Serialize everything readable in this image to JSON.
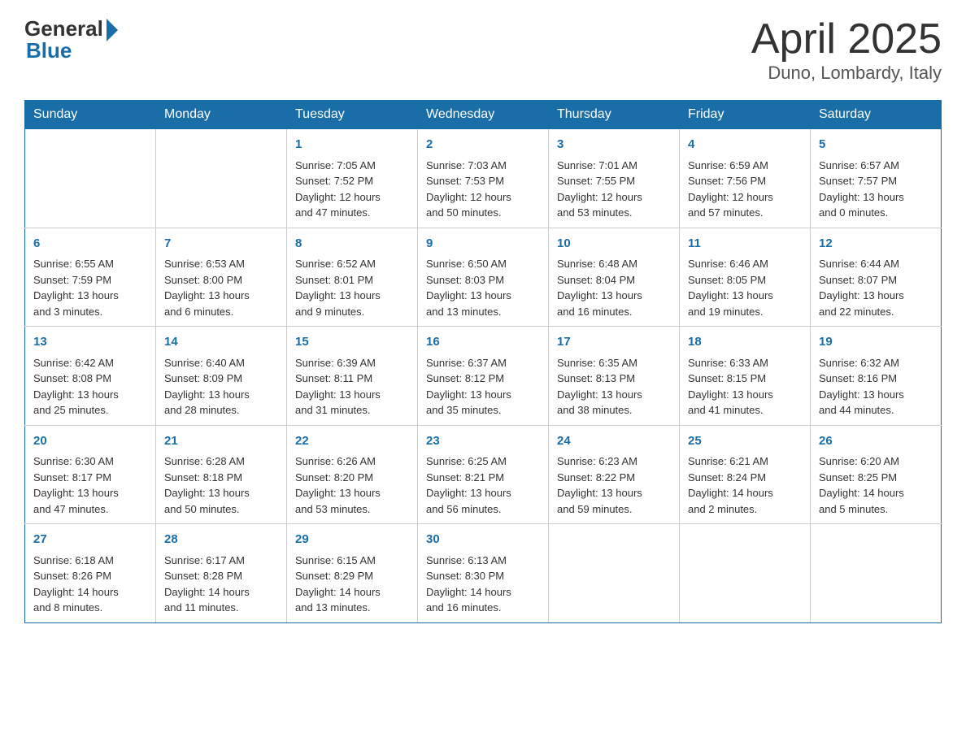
{
  "header": {
    "logo_general": "General",
    "logo_blue": "Blue",
    "title": "April 2025",
    "subtitle": "Duno, Lombardy, Italy"
  },
  "days_of_week": [
    "Sunday",
    "Monday",
    "Tuesday",
    "Wednesday",
    "Thursday",
    "Friday",
    "Saturday"
  ],
  "weeks": [
    [
      {
        "day": "",
        "info": ""
      },
      {
        "day": "",
        "info": ""
      },
      {
        "day": "1",
        "info": "Sunrise: 7:05 AM\nSunset: 7:52 PM\nDaylight: 12 hours\nand 47 minutes."
      },
      {
        "day": "2",
        "info": "Sunrise: 7:03 AM\nSunset: 7:53 PM\nDaylight: 12 hours\nand 50 minutes."
      },
      {
        "day": "3",
        "info": "Sunrise: 7:01 AM\nSunset: 7:55 PM\nDaylight: 12 hours\nand 53 minutes."
      },
      {
        "day": "4",
        "info": "Sunrise: 6:59 AM\nSunset: 7:56 PM\nDaylight: 12 hours\nand 57 minutes."
      },
      {
        "day": "5",
        "info": "Sunrise: 6:57 AM\nSunset: 7:57 PM\nDaylight: 13 hours\nand 0 minutes."
      }
    ],
    [
      {
        "day": "6",
        "info": "Sunrise: 6:55 AM\nSunset: 7:59 PM\nDaylight: 13 hours\nand 3 minutes."
      },
      {
        "day": "7",
        "info": "Sunrise: 6:53 AM\nSunset: 8:00 PM\nDaylight: 13 hours\nand 6 minutes."
      },
      {
        "day": "8",
        "info": "Sunrise: 6:52 AM\nSunset: 8:01 PM\nDaylight: 13 hours\nand 9 minutes."
      },
      {
        "day": "9",
        "info": "Sunrise: 6:50 AM\nSunset: 8:03 PM\nDaylight: 13 hours\nand 13 minutes."
      },
      {
        "day": "10",
        "info": "Sunrise: 6:48 AM\nSunset: 8:04 PM\nDaylight: 13 hours\nand 16 minutes."
      },
      {
        "day": "11",
        "info": "Sunrise: 6:46 AM\nSunset: 8:05 PM\nDaylight: 13 hours\nand 19 minutes."
      },
      {
        "day": "12",
        "info": "Sunrise: 6:44 AM\nSunset: 8:07 PM\nDaylight: 13 hours\nand 22 minutes."
      }
    ],
    [
      {
        "day": "13",
        "info": "Sunrise: 6:42 AM\nSunset: 8:08 PM\nDaylight: 13 hours\nand 25 minutes."
      },
      {
        "day": "14",
        "info": "Sunrise: 6:40 AM\nSunset: 8:09 PM\nDaylight: 13 hours\nand 28 minutes."
      },
      {
        "day": "15",
        "info": "Sunrise: 6:39 AM\nSunset: 8:11 PM\nDaylight: 13 hours\nand 31 minutes."
      },
      {
        "day": "16",
        "info": "Sunrise: 6:37 AM\nSunset: 8:12 PM\nDaylight: 13 hours\nand 35 minutes."
      },
      {
        "day": "17",
        "info": "Sunrise: 6:35 AM\nSunset: 8:13 PM\nDaylight: 13 hours\nand 38 minutes."
      },
      {
        "day": "18",
        "info": "Sunrise: 6:33 AM\nSunset: 8:15 PM\nDaylight: 13 hours\nand 41 minutes."
      },
      {
        "day": "19",
        "info": "Sunrise: 6:32 AM\nSunset: 8:16 PM\nDaylight: 13 hours\nand 44 minutes."
      }
    ],
    [
      {
        "day": "20",
        "info": "Sunrise: 6:30 AM\nSunset: 8:17 PM\nDaylight: 13 hours\nand 47 minutes."
      },
      {
        "day": "21",
        "info": "Sunrise: 6:28 AM\nSunset: 8:18 PM\nDaylight: 13 hours\nand 50 minutes."
      },
      {
        "day": "22",
        "info": "Sunrise: 6:26 AM\nSunset: 8:20 PM\nDaylight: 13 hours\nand 53 minutes."
      },
      {
        "day": "23",
        "info": "Sunrise: 6:25 AM\nSunset: 8:21 PM\nDaylight: 13 hours\nand 56 minutes."
      },
      {
        "day": "24",
        "info": "Sunrise: 6:23 AM\nSunset: 8:22 PM\nDaylight: 13 hours\nand 59 minutes."
      },
      {
        "day": "25",
        "info": "Sunrise: 6:21 AM\nSunset: 8:24 PM\nDaylight: 14 hours\nand 2 minutes."
      },
      {
        "day": "26",
        "info": "Sunrise: 6:20 AM\nSunset: 8:25 PM\nDaylight: 14 hours\nand 5 minutes."
      }
    ],
    [
      {
        "day": "27",
        "info": "Sunrise: 6:18 AM\nSunset: 8:26 PM\nDaylight: 14 hours\nand 8 minutes."
      },
      {
        "day": "28",
        "info": "Sunrise: 6:17 AM\nSunset: 8:28 PM\nDaylight: 14 hours\nand 11 minutes."
      },
      {
        "day": "29",
        "info": "Sunrise: 6:15 AM\nSunset: 8:29 PM\nDaylight: 14 hours\nand 13 minutes."
      },
      {
        "day": "30",
        "info": "Sunrise: 6:13 AM\nSunset: 8:30 PM\nDaylight: 14 hours\nand 16 minutes."
      },
      {
        "day": "",
        "info": ""
      },
      {
        "day": "",
        "info": ""
      },
      {
        "day": "",
        "info": ""
      }
    ]
  ]
}
